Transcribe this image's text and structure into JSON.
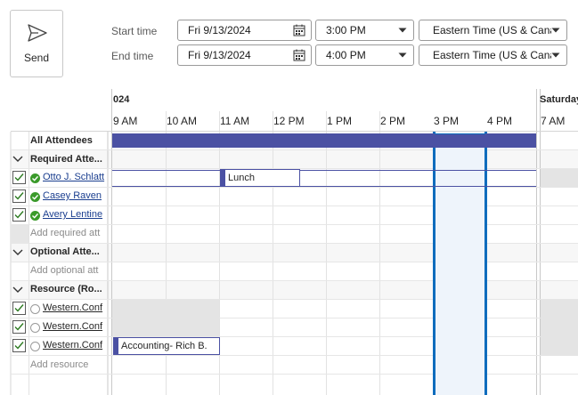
{
  "send": {
    "label": "Send",
    "icon": "send-icon"
  },
  "times": {
    "start_label": "Start time",
    "end_label": "End time",
    "start_date": "Fri 9/13/2024",
    "start_time": "3:00 PM",
    "end_date": "Fri 9/13/2024",
    "end_time": "4:00 PM",
    "start_tz": "Eastern Time (US & Cana",
    "end_tz": "Eastern Time (US & Cana"
  },
  "grid": {
    "date_label": "024",
    "next_day_label": "Saturday",
    "hours": [
      "9 AM",
      "10 AM",
      "11 AM",
      "12 PM",
      "1 PM",
      "2 PM",
      "3 PM",
      "4 PM",
      "7 AM"
    ],
    "all_attendees": "All Attendees",
    "sections": {
      "required": "Required Atte...",
      "optional": "Optional Atte...",
      "resource": "Resource (Ro..."
    },
    "attendees": [
      {
        "name": "Otto J. Schlatt",
        "status": "ok"
      },
      {
        "name": "Casey Raven",
        "status": "ok"
      },
      {
        "name": "Avery Lentine",
        "status": "ok"
      }
    ],
    "add_required": "Add required att",
    "add_optional": "Add optional att",
    "resources": [
      {
        "name": "Western.Conf"
      },
      {
        "name": "Western.Conf"
      },
      {
        "name": "Western.Conf"
      }
    ],
    "add_resource": "Add resource",
    "appointments": {
      "lunch": "Lunch",
      "accounting": "Accounting- Rich B."
    }
  },
  "colors": {
    "busy": "#4b51a3",
    "selection": "#0f6cbd",
    "selection_fill": "#eef4fb",
    "gray": "#e4e4e4"
  }
}
